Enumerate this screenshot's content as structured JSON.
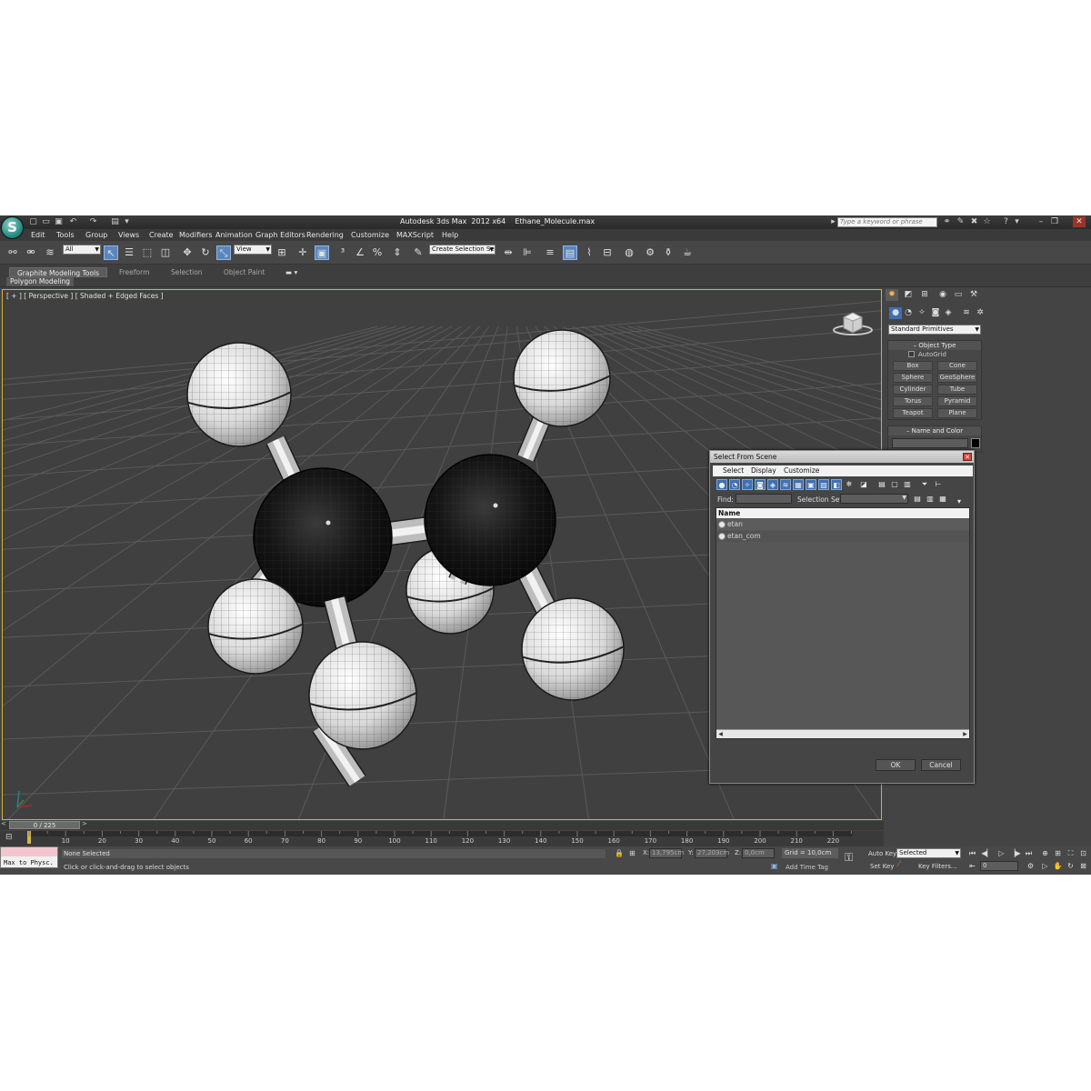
{
  "titlebar": {
    "app_name": "Autodesk 3ds Max  2012 x64",
    "file_name": "Ethane_Molecule.max",
    "search_placeholder": "Type a keyword or phrase"
  },
  "menu": [
    "Edit",
    "Tools",
    "Group",
    "Views",
    "Create",
    "Modifiers",
    "Animation",
    "Graph Editors",
    "Rendering",
    "Customize",
    "MAXScript",
    "Help"
  ],
  "toolbar": {
    "selection_filter": "All",
    "ref_coord": "View",
    "named_selection": "Create Selection Se"
  },
  "ribbon": {
    "tabs": [
      "Graphite Modeling Tools",
      "Freeform",
      "Selection",
      "Object Paint"
    ],
    "active_tab": "Graphite Modeling Tools",
    "subpanel": "Polygon Modeling"
  },
  "viewport": {
    "label": "[ + ] [ Perspective ] [ Shaded + Edged Faces ]",
    "atom_colors": {
      "carbon": "#111111",
      "hydrogen": "#eeeeee"
    }
  },
  "command_panel": {
    "category": "Standard Primitives",
    "object_type_title": "Object Type",
    "autogrid_label": "AutoGrid",
    "object_buttons": [
      "Box",
      "Cone",
      "Sphere",
      "GeoSphere",
      "Cylinder",
      "Tube",
      "Torus",
      "Pyramid",
      "Teapot",
      "Plane"
    ],
    "name_color_title": "Name and Color"
  },
  "dialog": {
    "title": "Select From Scene",
    "menu": [
      "Select",
      "Display",
      "Customize"
    ],
    "find_label": "Find:",
    "selection_set_label": "Selection Set:",
    "column_name": "Name",
    "objects": [
      "etan",
      "etan_com"
    ],
    "ok_label": "OK",
    "cancel_label": "Cancel"
  },
  "timeline": {
    "frame_label": "0 / 225",
    "ticks": [
      "10",
      "20",
      "30",
      "40",
      "50",
      "60",
      "70",
      "80",
      "90",
      "100",
      "110",
      "120",
      "130",
      "140",
      "150",
      "160",
      "170",
      "180",
      "190",
      "200",
      "210",
      "220"
    ]
  },
  "status": {
    "maxscript_listener": "Max to Physc.",
    "selection_message": "None Selected",
    "prompt": "Click or click-and-drag to select objects",
    "x_label": "X:",
    "x_value": "13,795cm",
    "y_label": "Y:",
    "y_value": "27,203cm",
    "z_label": "Z:",
    "z_value": "0,0cm",
    "grid": "Grid = 10,0cm",
    "add_time_tag": "Add Time Tag",
    "auto_key": "Auto Key",
    "set_key": "Set Key",
    "key_mode": "Selected",
    "key_filters": "Key Filters...",
    "current_frame": "0"
  }
}
